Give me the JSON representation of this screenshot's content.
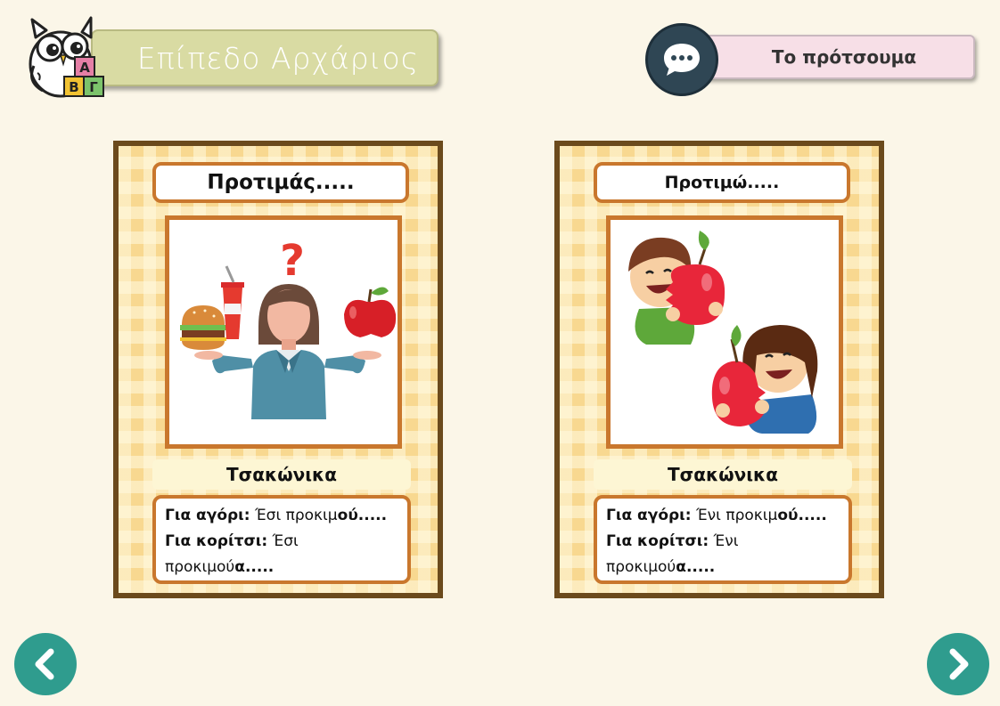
{
  "header": {
    "level_title": "Επίπεδο Αρχάριος",
    "logo_letters": [
      "Α",
      "Β",
      "Γ"
    ],
    "proverb_button": "Το πρότσουμα"
  },
  "cards": [
    {
      "title": "Προτιμάς.....",
      "language": "Τσακώνικα",
      "boy_label": "Για αγόρι:",
      "boy_text_plain": " Έσι προκιμ",
      "boy_text_bold": "ού.....",
      "girl_label": "Για κορίτσι:",
      "girl_text_plain": " Έσι προκιμού",
      "girl_text_bold": "α.....",
      "image": "woman-choosing-between-burger-and-apple"
    },
    {
      "title": "Προτιμώ.....",
      "language": "Τσακώνικα",
      "boy_label": "Για αγόρι:",
      "boy_text_plain": " Ένι προκιμ",
      "boy_text_bold": "ού.....",
      "girl_label": "Για κορίτσι:",
      "girl_text_plain": " Ένι προκιμού",
      "girl_text_bold": "α.....",
      "image": "kids-eating-apples"
    }
  ],
  "nav": {
    "prev_icon": "chevron-left-icon",
    "next_icon": "chevron-right-icon"
  },
  "colors": {
    "background": "#fbf6e8",
    "level_pill": "#d9dba3",
    "proverb_pill": "#f7dfe7",
    "card_border": "#6b4a1c",
    "frame_orange": "#c9772d",
    "nav_teal": "#2f9c8e"
  }
}
